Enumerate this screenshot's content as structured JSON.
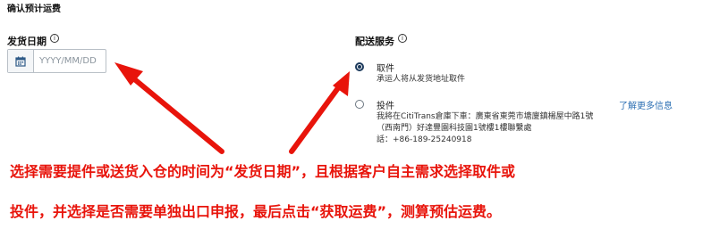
{
  "section_title": "确认预计运费",
  "ship_date": {
    "label": "发货日期",
    "info_symbol": "i",
    "placeholder": "YYYY/MM/DD",
    "calendar_icon": "calendar-icon"
  },
  "delivery": {
    "label": "配送服务",
    "info_symbol": "i",
    "options": [
      {
        "title": "取件",
        "description": "承运人将从发货地址取件",
        "selected": true
      },
      {
        "title": "投件",
        "address_line1": "我將在CitiTrans倉庫下車：廣東省東莞市塘廈鎮楊屋中路1號",
        "address_line2": "（西南門）好達豐園科技園1號樓1樓聯繫處",
        "phone": "話：+86-189-25240918",
        "selected": false
      }
    ],
    "more_info_link": "了解更多信息"
  },
  "annotation": {
    "line1": "选择需要提件或送货入仓的时间为“发货日期”，且根据客户自主需求选择取件或",
    "line2": "投件，并选择是否需要单独出口申报，最后点击“获取运费”，测算预估运费。",
    "color": "#e8140b"
  }
}
